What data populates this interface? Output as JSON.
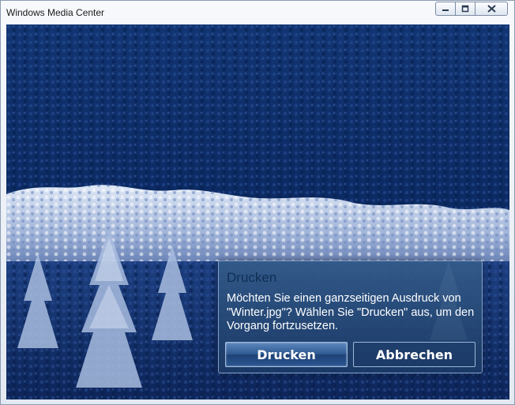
{
  "window": {
    "title": "Windows Media Center",
    "controls": [
      "minimize-icon",
      "restore-icon",
      "close-icon"
    ]
  },
  "dialog": {
    "title": "Drucken",
    "message": "Möchten Sie einen ganzseitigen Ausdruck von \"Winter.jpg\"? Wählen Sie \"Drucken\" aus, um den Vorgang fortzusetzen.",
    "primary_button": "Drucken",
    "secondary_button": "Abbrechen"
  },
  "background": {
    "description_icon": "winter-forest-photo",
    "colors": {
      "sky": "#0d2a66",
      "forest": "#122f6e",
      "snow": "#c9d6ec"
    }
  }
}
